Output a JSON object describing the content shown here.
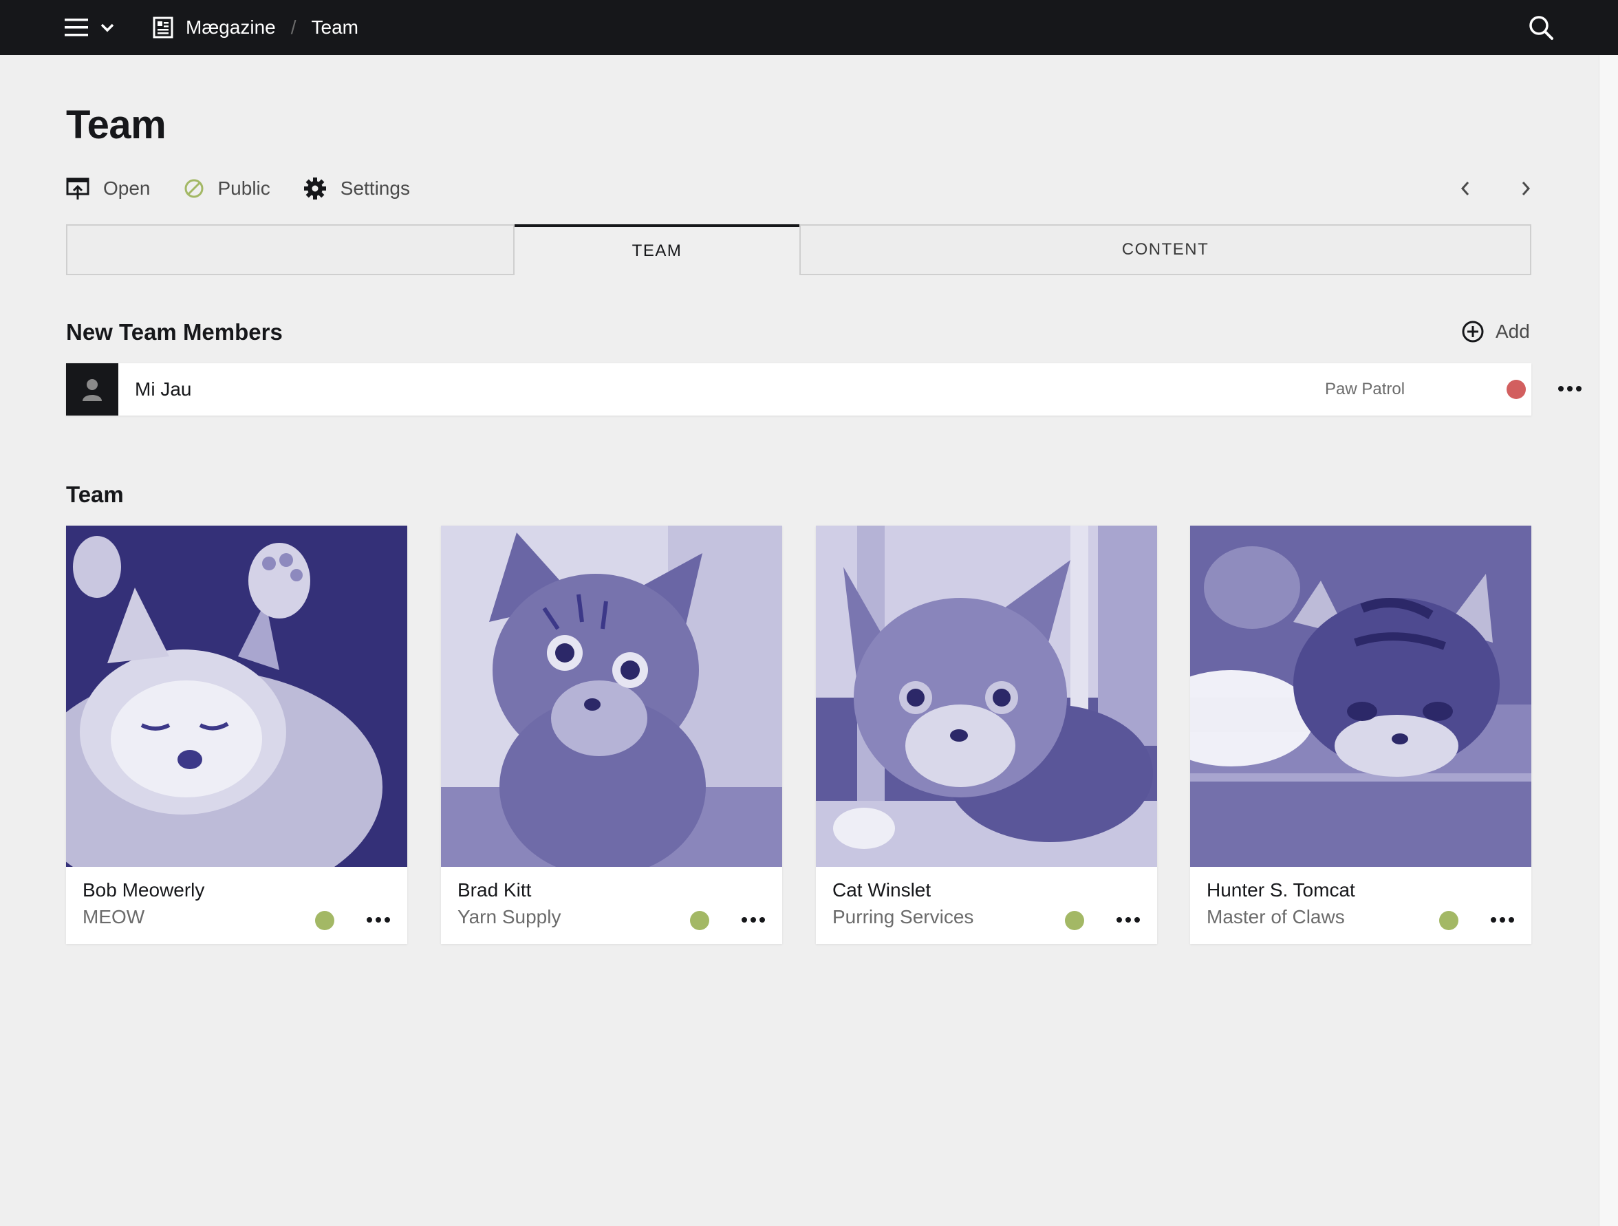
{
  "topbar": {
    "site_name": "Mægazine",
    "separator": "/",
    "page": "Team"
  },
  "header": {
    "title": "Team",
    "actions": {
      "open": "Open",
      "public": "Public",
      "settings": "Settings"
    }
  },
  "tabs": {
    "team": "TEAM",
    "content": "CONTENT"
  },
  "new_members": {
    "heading": "New Team Members",
    "add_label": "Add",
    "items": [
      {
        "name": "Mi Jau",
        "role": "Paw Patrol",
        "status_color": "#d25f5f"
      }
    ]
  },
  "team": {
    "heading": "Team",
    "members": [
      {
        "name": "Bob Meowerly",
        "role": "MEOW",
        "status_color": "#a3b865"
      },
      {
        "name": "Brad Kitt",
        "role": "Yarn Supply",
        "status_color": "#a3b865"
      },
      {
        "name": "Cat Winslet",
        "role": "Purring Services",
        "status_color": "#a3b865"
      },
      {
        "name": "Hunter S. Tomcat",
        "role": "Master of Claws",
        "status_color": "#a3b865"
      }
    ]
  },
  "colors": {
    "topbar": "#16171a",
    "background": "#efefef",
    "photo_tint": "#3c3888",
    "status_ok": "#a3b865",
    "status_error": "#d25f5f"
  }
}
